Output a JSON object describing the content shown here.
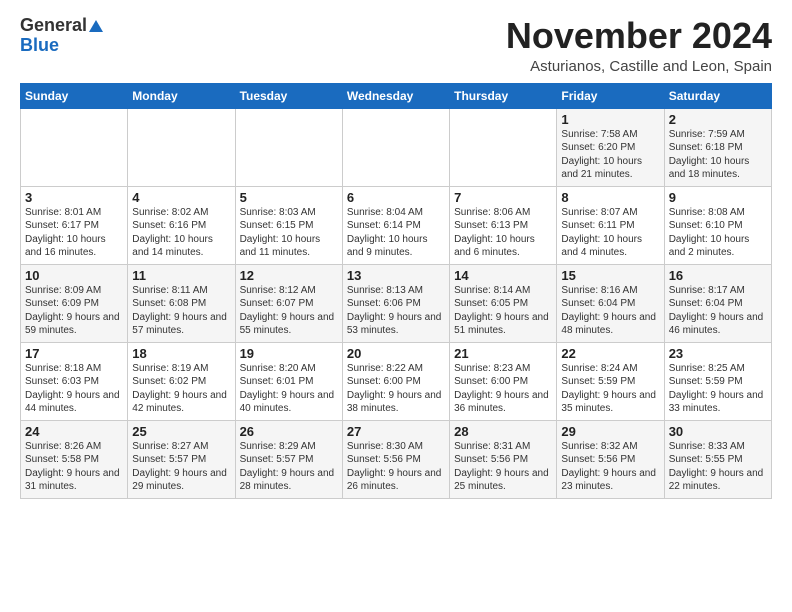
{
  "logo": {
    "general": "General",
    "blue": "Blue"
  },
  "title": "November 2024",
  "subtitle": "Asturianos, Castille and Leon, Spain",
  "days_header": [
    "Sunday",
    "Monday",
    "Tuesday",
    "Wednesday",
    "Thursday",
    "Friday",
    "Saturday"
  ],
  "weeks": [
    [
      {
        "day": "",
        "info": ""
      },
      {
        "day": "",
        "info": ""
      },
      {
        "day": "",
        "info": ""
      },
      {
        "day": "",
        "info": ""
      },
      {
        "day": "",
        "info": ""
      },
      {
        "day": "1",
        "info": "Sunrise: 7:58 AM\nSunset: 6:20 PM\nDaylight: 10 hours and 21 minutes."
      },
      {
        "day": "2",
        "info": "Sunrise: 7:59 AM\nSunset: 6:18 PM\nDaylight: 10 hours and 18 minutes."
      }
    ],
    [
      {
        "day": "3",
        "info": "Sunrise: 8:01 AM\nSunset: 6:17 PM\nDaylight: 10 hours and 16 minutes."
      },
      {
        "day": "4",
        "info": "Sunrise: 8:02 AM\nSunset: 6:16 PM\nDaylight: 10 hours and 14 minutes."
      },
      {
        "day": "5",
        "info": "Sunrise: 8:03 AM\nSunset: 6:15 PM\nDaylight: 10 hours and 11 minutes."
      },
      {
        "day": "6",
        "info": "Sunrise: 8:04 AM\nSunset: 6:14 PM\nDaylight: 10 hours and 9 minutes."
      },
      {
        "day": "7",
        "info": "Sunrise: 8:06 AM\nSunset: 6:13 PM\nDaylight: 10 hours and 6 minutes."
      },
      {
        "day": "8",
        "info": "Sunrise: 8:07 AM\nSunset: 6:11 PM\nDaylight: 10 hours and 4 minutes."
      },
      {
        "day": "9",
        "info": "Sunrise: 8:08 AM\nSunset: 6:10 PM\nDaylight: 10 hours and 2 minutes."
      }
    ],
    [
      {
        "day": "10",
        "info": "Sunrise: 8:09 AM\nSunset: 6:09 PM\nDaylight: 9 hours and 59 minutes."
      },
      {
        "day": "11",
        "info": "Sunrise: 8:11 AM\nSunset: 6:08 PM\nDaylight: 9 hours and 57 minutes."
      },
      {
        "day": "12",
        "info": "Sunrise: 8:12 AM\nSunset: 6:07 PM\nDaylight: 9 hours and 55 minutes."
      },
      {
        "day": "13",
        "info": "Sunrise: 8:13 AM\nSunset: 6:06 PM\nDaylight: 9 hours and 53 minutes."
      },
      {
        "day": "14",
        "info": "Sunrise: 8:14 AM\nSunset: 6:05 PM\nDaylight: 9 hours and 51 minutes."
      },
      {
        "day": "15",
        "info": "Sunrise: 8:16 AM\nSunset: 6:04 PM\nDaylight: 9 hours and 48 minutes."
      },
      {
        "day": "16",
        "info": "Sunrise: 8:17 AM\nSunset: 6:04 PM\nDaylight: 9 hours and 46 minutes."
      }
    ],
    [
      {
        "day": "17",
        "info": "Sunrise: 8:18 AM\nSunset: 6:03 PM\nDaylight: 9 hours and 44 minutes."
      },
      {
        "day": "18",
        "info": "Sunrise: 8:19 AM\nSunset: 6:02 PM\nDaylight: 9 hours and 42 minutes."
      },
      {
        "day": "19",
        "info": "Sunrise: 8:20 AM\nSunset: 6:01 PM\nDaylight: 9 hours and 40 minutes."
      },
      {
        "day": "20",
        "info": "Sunrise: 8:22 AM\nSunset: 6:00 PM\nDaylight: 9 hours and 38 minutes."
      },
      {
        "day": "21",
        "info": "Sunrise: 8:23 AM\nSunset: 6:00 PM\nDaylight: 9 hours and 36 minutes."
      },
      {
        "day": "22",
        "info": "Sunrise: 8:24 AM\nSunset: 5:59 PM\nDaylight: 9 hours and 35 minutes."
      },
      {
        "day": "23",
        "info": "Sunrise: 8:25 AM\nSunset: 5:59 PM\nDaylight: 9 hours and 33 minutes."
      }
    ],
    [
      {
        "day": "24",
        "info": "Sunrise: 8:26 AM\nSunset: 5:58 PM\nDaylight: 9 hours and 31 minutes."
      },
      {
        "day": "25",
        "info": "Sunrise: 8:27 AM\nSunset: 5:57 PM\nDaylight: 9 hours and 29 minutes."
      },
      {
        "day": "26",
        "info": "Sunrise: 8:29 AM\nSunset: 5:57 PM\nDaylight: 9 hours and 28 minutes."
      },
      {
        "day": "27",
        "info": "Sunrise: 8:30 AM\nSunset: 5:56 PM\nDaylight: 9 hours and 26 minutes."
      },
      {
        "day": "28",
        "info": "Sunrise: 8:31 AM\nSunset: 5:56 PM\nDaylight: 9 hours and 25 minutes."
      },
      {
        "day": "29",
        "info": "Sunrise: 8:32 AM\nSunset: 5:56 PM\nDaylight: 9 hours and 23 minutes."
      },
      {
        "day": "30",
        "info": "Sunrise: 8:33 AM\nSunset: 5:55 PM\nDaylight: 9 hours and 22 minutes."
      }
    ]
  ]
}
